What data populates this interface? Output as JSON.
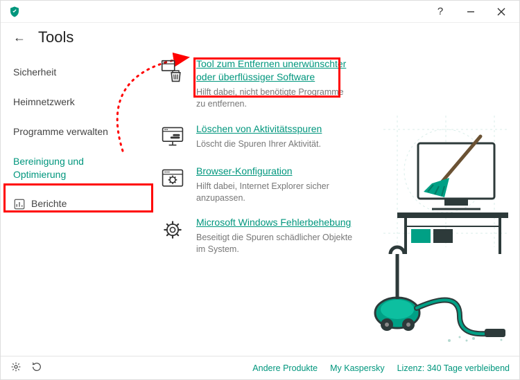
{
  "page_title": "Tools",
  "sidebar": {
    "items": [
      {
        "label": "Sicherheit"
      },
      {
        "label": "Heimnetzwerk"
      },
      {
        "label": "Programme verwalten"
      },
      {
        "label": "Bereinigung und Optimierung"
      },
      {
        "label": "Berichte"
      }
    ]
  },
  "tools": [
    {
      "link": "Tool zum Entfernen unerwünschter oder überflüssiger Software",
      "desc": "Hilft dabei, nicht benötigte Programme zu entfernen."
    },
    {
      "link": "Löschen von Aktivitätsspuren",
      "desc": "Löscht die Spuren Ihrer Aktivität."
    },
    {
      "link": "Browser-Konfiguration",
      "desc": "Hilft dabei, Internet Explorer sicher anzupassen."
    },
    {
      "link": "Microsoft Windows Fehlerbehebung",
      "desc": "Beseitigt die Spuren schädlicher Objekte im System."
    }
  ],
  "footer": {
    "other_products": "Andere Produkte",
    "my_kaspersky": "My Kaspersky",
    "license": "Lizenz: 340 Tage verbleibend"
  },
  "colors": {
    "accent": "#00967d",
    "highlight": "#ff0000"
  }
}
